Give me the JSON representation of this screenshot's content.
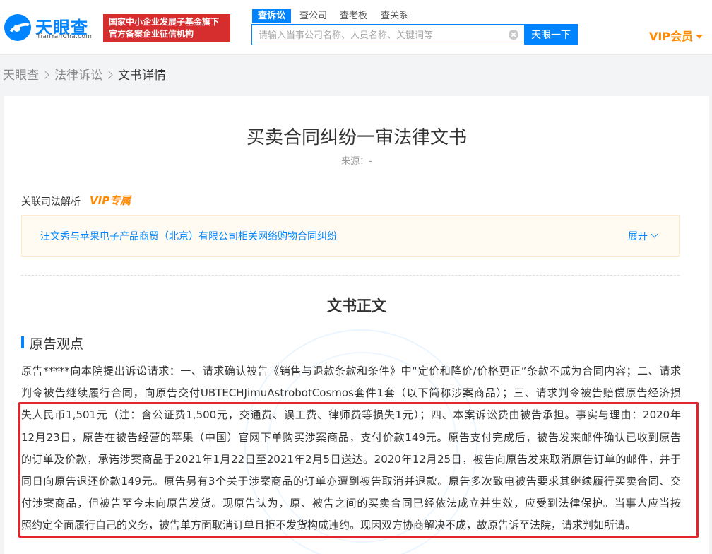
{
  "header": {
    "logo_name": "天眼查",
    "logo_domain": "TianYanCha.com",
    "badge_line1": "国家中小企业发展子基金旗下",
    "badge_line2": "官方备案企业征信机构",
    "search_tabs": [
      "查诉讼",
      "查公司",
      "查老板",
      "查关系"
    ],
    "search_placeholder": "请输入当事公司名称、人员名称、关键词等",
    "search_button": "天眼一下",
    "vip_label": "VIP会员"
  },
  "breadcrumb": [
    "天眼查",
    "法律诉讼",
    "文书详情"
  ],
  "document": {
    "title": "买卖合同纠纷一审法律文书",
    "source": "来源：-",
    "related_label": "关联司法解析",
    "vip_tag": "VIP专属",
    "related_case": "汪文秀与苹果电子产品商贸（北京）有限公司相关网络购物合同纠纷",
    "expand_label": "展开",
    "section_title": "文书正文",
    "subsection_title": "原告观点",
    "body_lines": [
      "原告*****向本院提出诉讼请求：一、请求确认被告《销售与退款条款和条件》中“定价和降价/价格更正”条款不成为合同内容；二、请求",
      "判令被告继续履行合同，向原告交付UBTECHJimuAstrobotCosmos套件1套（以下简称涉案商品）；三、请求判令被告赔偿原告经济损",
      "失人民币1,501元（注：含公证费1,500元，交通费、误工费、律师费等损失1元）；四、本案诉讼费由被告承担。事实与理由：2020年",
      "12月23日，原告在被告经营的苹果（中国）官网下单购买涉案商品，支付价款149元。原告支付完成后，被告发来邮件确认已收到原告",
      "的订单及价款，承诺涉案商品于2021年1月22日至2021年2月5日送达。2020年12月25日，被告向原告发来取消原告订单的邮件，并于",
      "同日向原告退还价款149元。原告另有3个关于涉案商品的订单亦遭到被告取消并退款。原告多次致电被告要求其继续履行买卖合同、交",
      "付涉案商品，但被告至今未向原告发货。现原告认为，原、被告之间的买卖合同已经依法成立并生效，应受到法律保护。当事人应当按",
      "照约定全面履行自己的义务，被告单方面取消订单且拒不发货构成违约。现因双方协商解决不成，故原告诉至法院，请求判如所请。"
    ]
  },
  "colors": {
    "brand_blue": "#0084ff",
    "vip_orange": "#ff8a00",
    "badge_red": "#d62e2e",
    "highlight_red": "#e4242b"
  }
}
